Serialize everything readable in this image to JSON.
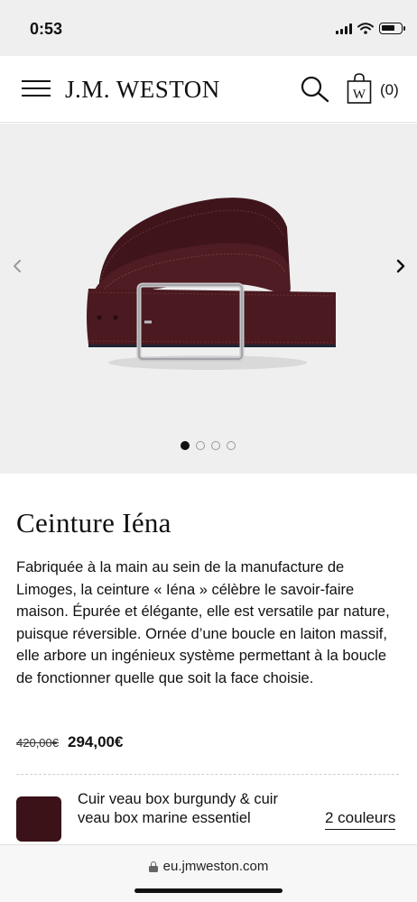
{
  "status_bar": {
    "time": "0:53",
    "battery_level": 0.75
  },
  "header": {
    "brand": "J.M. WESTON",
    "bag_count": "(0)",
    "bag_letter": "W",
    "icons": [
      "menu-icon",
      "search-icon",
      "shopping-bag-icon"
    ]
  },
  "carousel": {
    "slides_count": 4,
    "active_index": 0,
    "product_image": "burgundy reversible leather belt with silver buckle"
  },
  "product": {
    "title": "Ceinture Iéna",
    "description": "Fabriquée à la main au sein de la manufacture de Limoges, la ceinture « Iéna » célèbre le savoir-faire maison. Épurée et élégante, elle est versatile par nature, puisque réversible. Ornée d’une boucle en laiton massif, elle arbore un ingénieux système permettant à la boucle de fonctionner quelle que soit la face choisie.",
    "old_price": "420,00€",
    "price": "294,00€"
  },
  "variant": {
    "label": "Cuir veau box burgundy & cuir veau box marine essentiel",
    "colors_link": "2 couleurs",
    "swatch_color": "#3a1218"
  },
  "browser": {
    "url": "eu.jmweston.com"
  },
  "colors": {
    "carousel_bg": "#efeff0",
    "belt_leather": "#4a1a20",
    "text": "#111111"
  }
}
